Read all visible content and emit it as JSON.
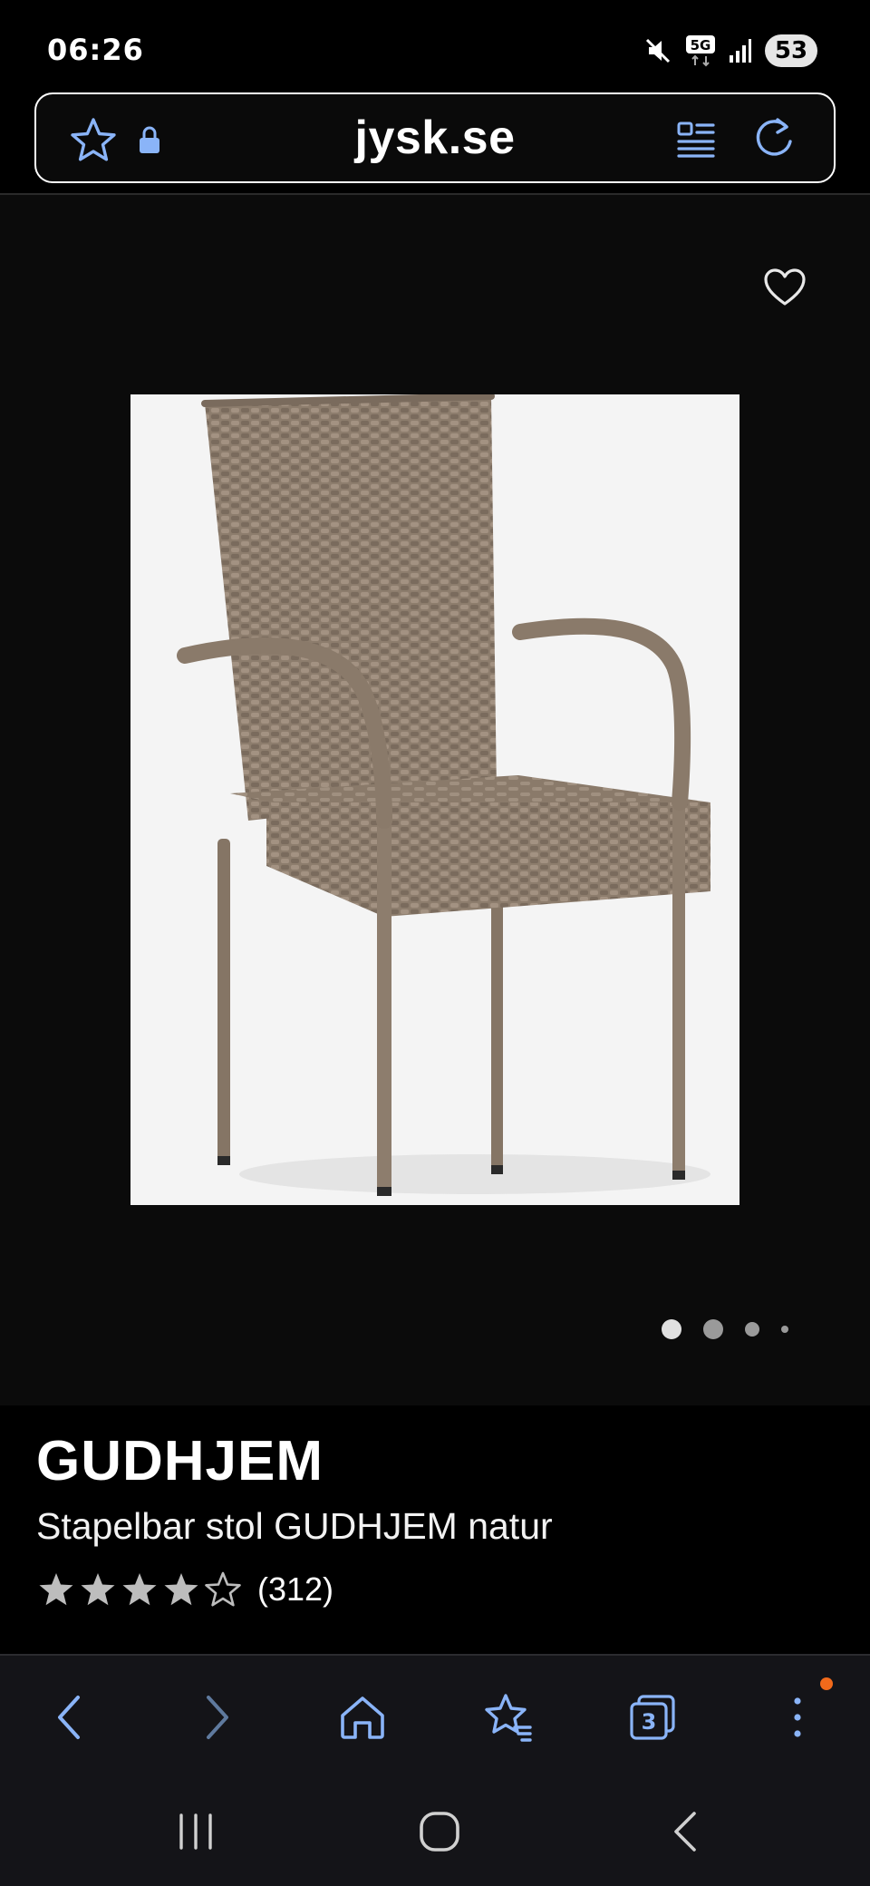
{
  "status": {
    "time": "06:26",
    "network_label": "5G",
    "battery": "53",
    "icons": [
      "mute-icon",
      "signal-5g-icon",
      "signal-bars-icon",
      "battery-icon"
    ]
  },
  "url_bar": {
    "domain": "jysk.se",
    "icons": [
      "star-icon",
      "lock-icon",
      "reader-mode-icon",
      "reload-icon"
    ]
  },
  "gallery": {
    "image_count": 4,
    "active_index": 0,
    "favorite_icon": "heart-icon"
  },
  "product": {
    "brand": "GUDHJEM",
    "name": "Stapelbar stol GUDHJEM natur",
    "rating": 4,
    "rating_max": 5,
    "review_count": "(312)"
  },
  "browser_nav": {
    "items": [
      "back-icon",
      "forward-icon",
      "home-icon",
      "bookmarks-icon",
      "tabs-icon",
      "menu-icon"
    ],
    "tab_count": "3"
  },
  "system_nav": {
    "items": [
      "recents-icon",
      "home-circle-icon",
      "back-chevron-icon"
    ]
  },
  "colors": {
    "background": "#000000",
    "accent": "#8ab4f8",
    "star": "#bdbdbd",
    "notification": "#f26a1b",
    "chair": "#8a7a6a"
  }
}
